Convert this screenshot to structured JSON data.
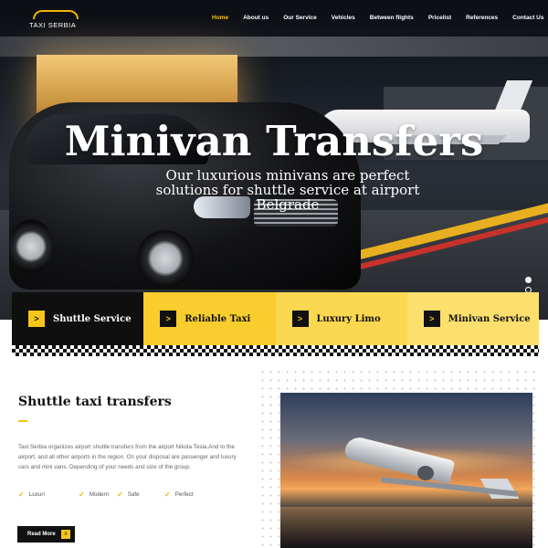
{
  "brand": {
    "logo_text": "TAXI SERBIA"
  },
  "nav": {
    "items": [
      "Home",
      "About us",
      "Our Service",
      "Vehicles",
      "Between flights",
      "Pricelist",
      "References",
      "Contact Us"
    ],
    "active": "Home"
  },
  "hero": {
    "title": "Minivan Transfers",
    "subtitle": "Our luxurious minivans are perfect solutions for shuttle service at airport Belgrade",
    "slide_count": 2,
    "active_slide": 1
  },
  "services": [
    {
      "label": "Shuttle Service",
      "icon": "chevron-right-icon"
    },
    {
      "label": "Reliable Taxi",
      "icon": "chevron-right-icon"
    },
    {
      "label": "Luxury Limo",
      "icon": "chevron-right-icon"
    },
    {
      "label": "Minivan Service",
      "icon": "chevron-right-icon"
    }
  ],
  "content": {
    "title": "Shuttle taxi transfers",
    "body": "Taxi Serbia organizes airport shuttle transfers from the airport Nikola Tesla.And to the airport, and all other airports in the region. On your disposal are passenger and luxury cars and mini vans. Depending of your needs and size of the group.",
    "features": [
      "Luxuri",
      "Modern",
      "Safe",
      "Perfect"
    ],
    "read_more_label": "Read More"
  },
  "colors": {
    "accent": "#f5c518",
    "dark": "#111111",
    "service_1": "#0f0f0f",
    "service_2": "#f9cd2d",
    "service_3": "#fbd84f",
    "service_4": "#fddf6e"
  }
}
